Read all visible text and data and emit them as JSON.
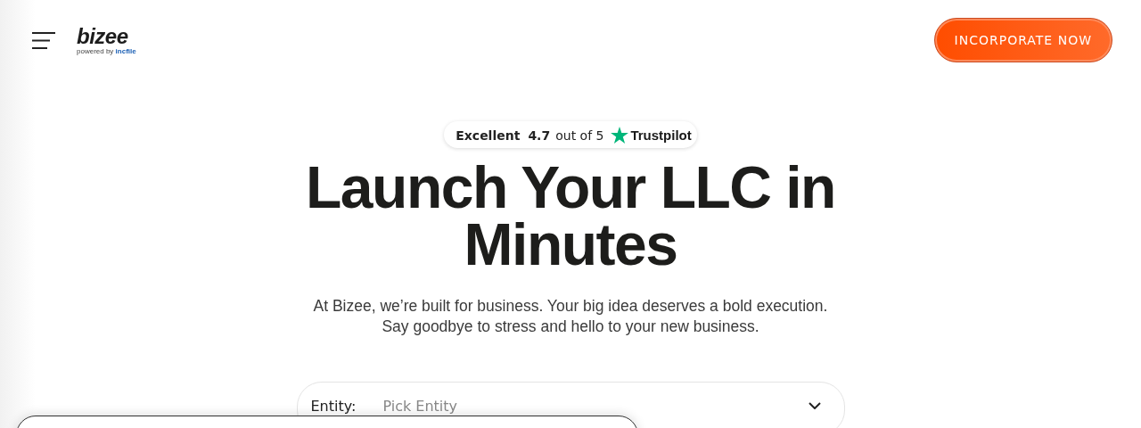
{
  "header": {
    "logo": {
      "wordmark": "bizee",
      "tagline": "powered by",
      "brand": "incfile"
    },
    "cta": "INCORPORATE NOW"
  },
  "rating": {
    "label": "Excellent",
    "score": "4.7",
    "suffix": "out of 5",
    "provider": "Trustpilot"
  },
  "hero": {
    "title": "Launch Your LLC in Minutes",
    "subtitle": "At Bizee, we’re built for business. Your big idea deserves a bold execution. Say goodbye to stress and hello to your new business."
  },
  "entity_select": {
    "label": "Entity:",
    "placeholder": "Pick Entity"
  }
}
